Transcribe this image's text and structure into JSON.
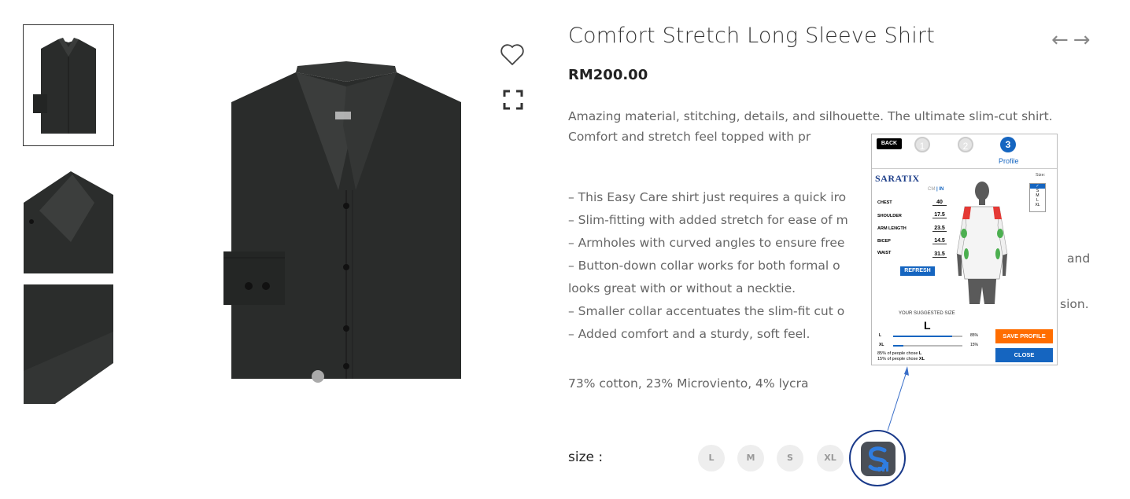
{
  "product": {
    "title": "Comfort Stretch Long Sleeve Shirt",
    "price": "RM200.00",
    "description": "Amazing material, stitching, details, and silhouette. The ultimate slim-cut shirt. Comfort and stretch feel topped with pr",
    "bullets": [
      "– This Easy Care shirt just requires a quick iro",
      "– Slim-fitting with added stretch for ease of m",
      "– Armholes with curved angles to ensure free",
      "– Button-down collar works for both formal o",
      "looks great with or without a necktie.",
      "– Smaller collar accentuates the slim-fit cut o",
      "– Added comfort and a sturdy, soft feel."
    ],
    "bullet_tails": {
      "collar_tail": "and",
      "smaller_tail": "sion."
    },
    "material": "73% cotton, 23% Microviento, 4% lycra",
    "nav_arrows": "←→"
  },
  "sizes": {
    "label": "size :",
    "options": [
      "L",
      "M",
      "S",
      "XL"
    ]
  },
  "popup": {
    "back": "BACK",
    "steps": [
      "1",
      "2",
      "3"
    ],
    "active_step_label": "Profile",
    "brand": "SARATIX",
    "units": {
      "cm": "CM",
      "sep": " | ",
      "in": "IN"
    },
    "measurements": [
      {
        "label": "CHEST",
        "value": "40"
      },
      {
        "label": "SHOULDER",
        "value": "17.5"
      },
      {
        "label": "ARM LENGTH",
        "value": "23.5"
      },
      {
        "label": "BICEP",
        "value": "14.5"
      },
      {
        "label": "WAIST",
        "value": "31.5"
      }
    ],
    "refresh": "REFRESH",
    "size_list_title": "Size:",
    "size_list": [
      "✓",
      "S",
      "M",
      "L",
      "XL"
    ],
    "suggested_label": "YOUR SUGGESTED SIZE",
    "suggested_size": "L",
    "bars": [
      {
        "label": "L",
        "pct_text": "85%",
        "fraction": 0.85
      },
      {
        "label": "XL",
        "pct_text": "15%",
        "fraction": 0.15
      }
    ],
    "chose_lines": [
      {
        "prefix": "85%  of people chose ",
        "size": "L"
      },
      {
        "prefix": "15% of people chose ",
        "size": "XL"
      }
    ],
    "save": "SAVE PROFILE",
    "close": "CLOSE"
  },
  "colors": {
    "accent_blue": "#1565c0",
    "save_orange": "#ff6d00",
    "shirt": "#2a2c2b"
  }
}
